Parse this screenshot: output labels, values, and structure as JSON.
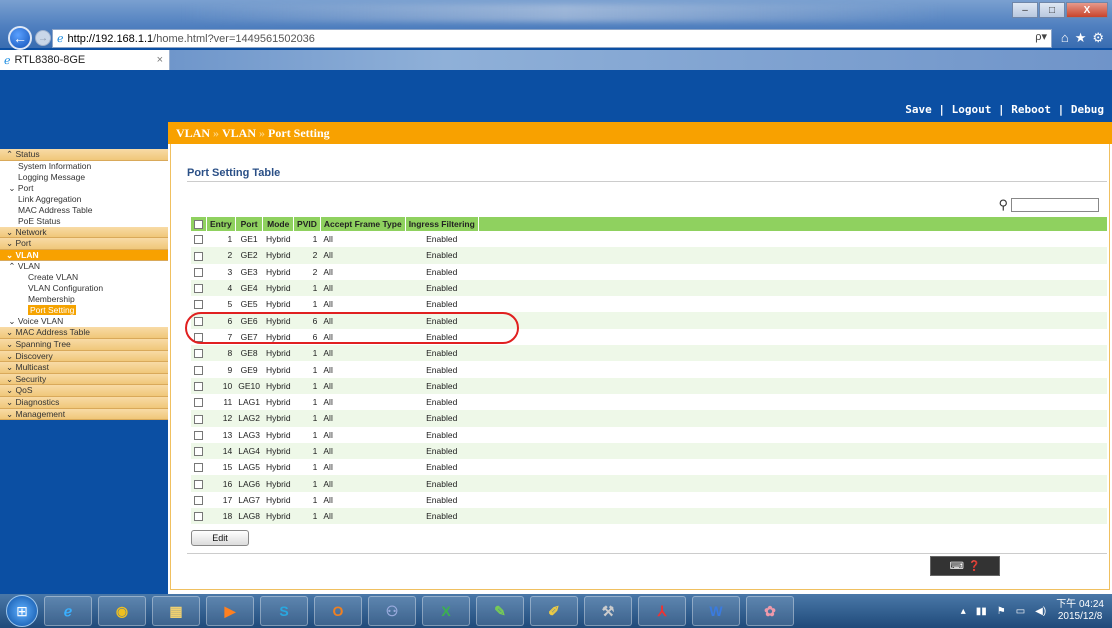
{
  "browser": {
    "url_host": "http://192.168.1.1",
    "url_rest": "/home.html?ver=1449561502036",
    "tab_title": "RTL8380-8GE",
    "tab_close": "×",
    "search_glyph": "ρ▾",
    "win_min": "–",
    "win_max": "□",
    "win_close": "X"
  },
  "top_links": {
    "save": "Save",
    "logout": "Logout",
    "reboot": "Reboot",
    "debug": "Debug",
    "sep": " | "
  },
  "breadcrumb": {
    "part1": "VLAN",
    "part2": "VLAN",
    "part3": "Port Setting",
    "sep": "»"
  },
  "sidebar": {
    "status": "Status",
    "system_information": "System Information",
    "logging_message": "Logging Message",
    "port_sub": "Port",
    "link_aggregation": "Link Aggregation",
    "mac_address_table_sub": "MAC Address Table",
    "poe_status": "PoE Status",
    "network": "Network",
    "port": "Port",
    "vlan": "VLAN",
    "vlan_sub": "VLAN",
    "create_vlan": "Create VLAN",
    "vlan_configuration": "VLAN Configuration",
    "membership": "Membership",
    "port_setting": "Port Setting",
    "voice_vlan": "Voice VLAN",
    "mac_address_table": "MAC Address Table",
    "spanning_tree": "Spanning Tree",
    "discovery": "Discovery",
    "multicast": "Multicast",
    "security": "Security",
    "qos": "QoS",
    "diagnostics": "Diagnostics",
    "management": "Management"
  },
  "main": {
    "section_title": "Port Setting Table",
    "edit_label": "Edit",
    "columns": [
      "Entry",
      "Port",
      "Mode",
      "PVID",
      "Accept Frame Type",
      "Ingress Filtering"
    ],
    "rows": [
      {
        "entry": "1",
        "port": "GE1",
        "mode": "Hybrid",
        "pvid": "1",
        "aft": "All",
        "ingress": "Enabled"
      },
      {
        "entry": "2",
        "port": "GE2",
        "mode": "Hybrid",
        "pvid": "2",
        "aft": "All",
        "ingress": "Enabled"
      },
      {
        "entry": "3",
        "port": "GE3",
        "mode": "Hybrid",
        "pvid": "2",
        "aft": "All",
        "ingress": "Enabled"
      },
      {
        "entry": "4",
        "port": "GE4",
        "mode": "Hybrid",
        "pvid": "1",
        "aft": "All",
        "ingress": "Enabled"
      },
      {
        "entry": "5",
        "port": "GE5",
        "mode": "Hybrid",
        "pvid": "1",
        "aft": "All",
        "ingress": "Enabled"
      },
      {
        "entry": "6",
        "port": "GE6",
        "mode": "Hybrid",
        "pvid": "6",
        "aft": "All",
        "ingress": "Enabled"
      },
      {
        "entry": "7",
        "port": "GE7",
        "mode": "Hybrid",
        "pvid": "6",
        "aft": "All",
        "ingress": "Enabled"
      },
      {
        "entry": "8",
        "port": "GE8",
        "mode": "Hybrid",
        "pvid": "1",
        "aft": "All",
        "ingress": "Enabled"
      },
      {
        "entry": "9",
        "port": "GE9",
        "mode": "Hybrid",
        "pvid": "1",
        "aft": "All",
        "ingress": "Enabled"
      },
      {
        "entry": "10",
        "port": "GE10",
        "mode": "Hybrid",
        "pvid": "1",
        "aft": "All",
        "ingress": "Enabled"
      },
      {
        "entry": "11",
        "port": "LAG1",
        "mode": "Hybrid",
        "pvid": "1",
        "aft": "All",
        "ingress": "Enabled"
      },
      {
        "entry": "12",
        "port": "LAG2",
        "mode": "Hybrid",
        "pvid": "1",
        "aft": "All",
        "ingress": "Enabled"
      },
      {
        "entry": "13",
        "port": "LAG3",
        "mode": "Hybrid",
        "pvid": "1",
        "aft": "All",
        "ingress": "Enabled"
      },
      {
        "entry": "14",
        "port": "LAG4",
        "mode": "Hybrid",
        "pvid": "1",
        "aft": "All",
        "ingress": "Enabled"
      },
      {
        "entry": "15",
        "port": "LAG5",
        "mode": "Hybrid",
        "pvid": "1",
        "aft": "All",
        "ingress": "Enabled"
      },
      {
        "entry": "16",
        "port": "LAG6",
        "mode": "Hybrid",
        "pvid": "1",
        "aft": "All",
        "ingress": "Enabled"
      },
      {
        "entry": "17",
        "port": "LAG7",
        "mode": "Hybrid",
        "pvid": "1",
        "aft": "All",
        "ingress": "Enabled"
      },
      {
        "entry": "18",
        "port": "LAG8",
        "mode": "Hybrid",
        "pvid": "1",
        "aft": "All",
        "ingress": "Enabled"
      }
    ]
  },
  "taskbar": {
    "time": "下午 04:24",
    "date": "2015/12/8"
  },
  "colors": {
    "accent": "#f8a100",
    "table_header": "#8fd15f",
    "highlight_ring": "#e02020"
  }
}
